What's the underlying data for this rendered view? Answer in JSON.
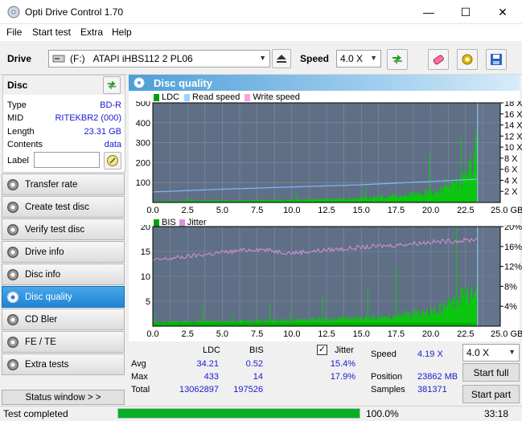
{
  "window": {
    "title": "Opti Drive Control 1.70",
    "min": "—",
    "max": "☐",
    "close": "✕"
  },
  "menu": {
    "file": "File",
    "start_test": "Start test",
    "extra": "Extra",
    "help": "Help"
  },
  "drivebar": {
    "drive_label": "Drive",
    "drive_letter": "(F:)",
    "drive_name": "ATAPI iHBS112   2 PL06",
    "speed_label": "Speed",
    "speed_value": "4.0 X"
  },
  "disc": {
    "header": "Disc",
    "type_k": "Type",
    "type_v": "BD-R",
    "mid_k": "MID",
    "mid_v": "RITEKBR2 (000)",
    "length_k": "Length",
    "length_v": "23.31 GB",
    "contents_k": "Contents",
    "contents_v": "data",
    "label_k": "Label",
    "label_v": ""
  },
  "nav": [
    {
      "label": "Transfer rate",
      "active": false
    },
    {
      "label": "Create test disc",
      "active": false
    },
    {
      "label": "Verify test disc",
      "active": false
    },
    {
      "label": "Drive info",
      "active": false
    },
    {
      "label": "Disc info",
      "active": false
    },
    {
      "label": "Disc quality",
      "active": true
    },
    {
      "label": "CD Bler",
      "active": false
    },
    {
      "label": "FE / TE",
      "active": false
    },
    {
      "label": "Extra tests",
      "active": false
    }
  ],
  "status_window_btn": "Status window > >",
  "main_title": "Disc quality",
  "colors": {
    "ldc": "#00c800",
    "read": "#7fb8ff",
    "write": "#ff8ee0",
    "bis": "#00c800",
    "jitter": "#d890d8",
    "plot_bg": "#5f6f86",
    "accent": "#1f84d6"
  },
  "chart_data": [
    {
      "type": "area",
      "legend": [
        "LDC",
        "Read speed",
        "Write speed"
      ],
      "x_ticks": [
        "0.0",
        "2.5",
        "5.0",
        "7.5",
        "10.0",
        "12.5",
        "15.0",
        "17.5",
        "20.0",
        "22.5",
        "25.0 GB"
      ],
      "xlim": [
        0,
        25
      ],
      "y_left_ticks": [
        "500",
        "400",
        "300",
        "200",
        "100"
      ],
      "ylim_left": [
        0,
        500
      ],
      "y_right_ticks": [
        "18 X",
        "16 X",
        "14 X",
        "12 X",
        "10 X",
        "8 X",
        "6 X",
        "4 X",
        "2 X"
      ],
      "ylim_right": [
        0,
        18
      ],
      "data_end_gb": 23.31,
      "ldc_envelope": {
        "x": [
          0,
          2.5,
          5,
          7.5,
          10,
          12.5,
          15,
          17.5,
          20,
          21,
          22,
          22.5,
          23,
          23.3
        ],
        "y": [
          8,
          10,
          12,
          14,
          18,
          22,
          30,
          45,
          70,
          90,
          130,
          170,
          260,
          433
        ]
      },
      "read_speed": {
        "x": [
          0,
          5,
          10,
          15,
          20,
          23.3
        ],
        "y": [
          1.9,
          2.4,
          2.8,
          3.2,
          3.8,
          4.19
        ]
      }
    },
    {
      "type": "area",
      "legend": [
        "BIS",
        "Jitter"
      ],
      "x_ticks": [
        "0.0",
        "2.5",
        "5.0",
        "7.5",
        "10.0",
        "12.5",
        "15.0",
        "17.5",
        "20.0",
        "22.5",
        "25.0 GB"
      ],
      "xlim": [
        0,
        25
      ],
      "y_left_ticks": [
        "20",
        "15",
        "10",
        "5"
      ],
      "ylim_left": [
        0,
        20
      ],
      "y_right_ticks": [
        "20%",
        "16%",
        "12%",
        "8%",
        "4%"
      ],
      "ylim_right": [
        0,
        20
      ],
      "bis_envelope": {
        "x": [
          0,
          5,
          10,
          15,
          17.5,
          20,
          21,
          22,
          22.5,
          23,
          23.3
        ],
        "y": [
          1,
          1.3,
          1.6,
          2.2,
          3,
          4,
          5.5,
          7.5,
          9,
          11,
          14
        ]
      },
      "jitter": {
        "x": [
          0,
          2.5,
          5,
          7.5,
          10,
          12.5,
          15,
          17.5,
          20,
          22.5,
          23.3
        ],
        "y": [
          13.2,
          14,
          14.8,
          15.5,
          14.7,
          15.3,
          15.8,
          16.3,
          16.9,
          17.2,
          17.5
        ]
      }
    }
  ],
  "stats": {
    "col_ldc": "LDC",
    "col_bis": "BIS",
    "jitter_label": "Jitter",
    "jitter_checked": true,
    "avg_label": "Avg",
    "avg_ldc": "34.21",
    "avg_bis": "0.52",
    "avg_jitter": "15.4%",
    "max_label": "Max",
    "max_ldc": "433",
    "max_bis": "14",
    "max_jitter": "17.9%",
    "total_label": "Total",
    "total_ldc": "13062897",
    "total_bis": "197526",
    "speed_label": "Speed",
    "speed_value": "4.19 X",
    "position_label": "Position",
    "position_value": "23862 MB",
    "samples_label": "Samples",
    "samples_value": "381371",
    "speed_select": "4.0 X",
    "start_full": "Start full",
    "start_part": "Start part"
  },
  "status": {
    "text": "Test completed",
    "progress": 100,
    "progress_text": "100.0%",
    "time": "33:18"
  }
}
